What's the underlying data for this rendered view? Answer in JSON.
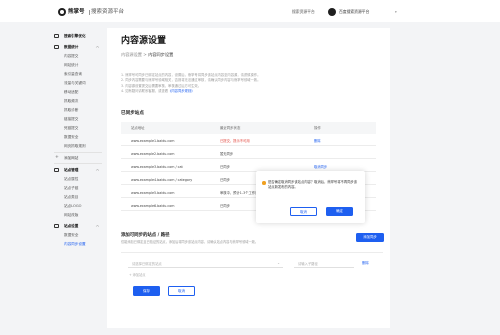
{
  "header": {
    "brand_name": "熊掌号",
    "brand_sub": "搜索资源平台",
    "link": "搜索资源平台",
    "user": "百度搜索资源平台",
    "caret": "▾"
  },
  "sidebar": {
    "groups": [
      {
        "label": "搜索引擎优化",
        "icon": "home-icon"
      },
      {
        "label": "数据统计",
        "icon": "chart-icon",
        "expanded": true,
        "items": [
          "内容提交",
          "网站统计",
          "索引量查询",
          "流量与关键词",
          "移动适配",
          "抓取频次",
          "抓取诊断",
          "链接提交",
          "死链提交",
          "数据安全",
          "网页抓取规则"
        ]
      },
      {
        "label": "站点管理",
        "icon": "site-icon",
        "expanded": true,
        "items": [
          "站点属性",
          "站点子链",
          "站点类目",
          "站点LOGO",
          "网站改版"
        ]
      },
      {
        "label": "站点设置",
        "icon": "gear-icon",
        "expanded": true,
        "items": [
          "数据安全",
          "内容同步设置"
        ]
      }
    ],
    "new_site_label": "添加网站",
    "active_item": "内容同步设置"
  },
  "main": {
    "title": "内容源设置",
    "breadcrumb": [
      "内容源设置",
      "内容同步设置"
    ],
    "breadcrumb_sep": " > ",
    "notes": [
      "1. 熊掌号可同步已绑定站点的内容，设置后，熊掌号将同步该站点内容至内容源，请谨慎操作。",
      "2. 同步内容需要与熊掌号领域相关，否则将无法通过审核，请确认同步内容与熊掌号领域一致。",
      "3. 内容源设置提交后需要审核，审核通过后方可生效。",
      "4. 如有疑问请联系客服，或查看"
    ],
    "note_link": "《内容同步规则》",
    "synced_title": "已同步站点",
    "table": {
      "headers": [
        "站点地址",
        "最近同步状态",
        "操作"
      ],
      "rows": [
        {
          "url": "www.example1.baidu.com",
          "status": "已提交，提示不可用",
          "status_kind": "red",
          "action": "删除"
        },
        {
          "url": "www.example2.baidu.com",
          "status": "暂无同步",
          "status_kind": "normal",
          "action": ""
        },
        {
          "url": "www.example3.baidu.com / cat",
          "status": "已同步",
          "status_kind": "normal",
          "action": "取消同步"
        },
        {
          "url": "www.example4.baidu.com / category",
          "status": "已同步",
          "status_kind": "normal",
          "action": ""
        },
        {
          "url": "www.example5.baidu.com",
          "status": "审核中，预计1-3个工作日",
          "status_kind": "normal",
          "action": ""
        },
        {
          "url": "www.example6.baidu.com",
          "status": "已同步",
          "status_kind": "normal",
          "action": ""
        }
      ]
    },
    "popover": {
      "text": "是否确定取消同步该站点内容？取消后，熊掌号将不再同步该站点新发布的内容。",
      "cancel": "取消",
      "confirm": "确定"
    },
    "add_section": {
      "title": "添加可同步的站点 / 路径",
      "desc": "仅能添加已绑定且已验证的站点，添加后将同步该站点内容，请确认站点内容与熊掌号领域一致。",
      "add_button": "添加同步",
      "select_placeholder": "请选择已绑定的站点",
      "path_placeholder": "请输入子路径",
      "delete": "删除",
      "hint": "+ 添加站点",
      "save": "保存",
      "cancel": "取消"
    }
  },
  "colors": {
    "accent": "#1e5ff0",
    "error": "#e2453c",
    "warning": "#f0a020"
  }
}
